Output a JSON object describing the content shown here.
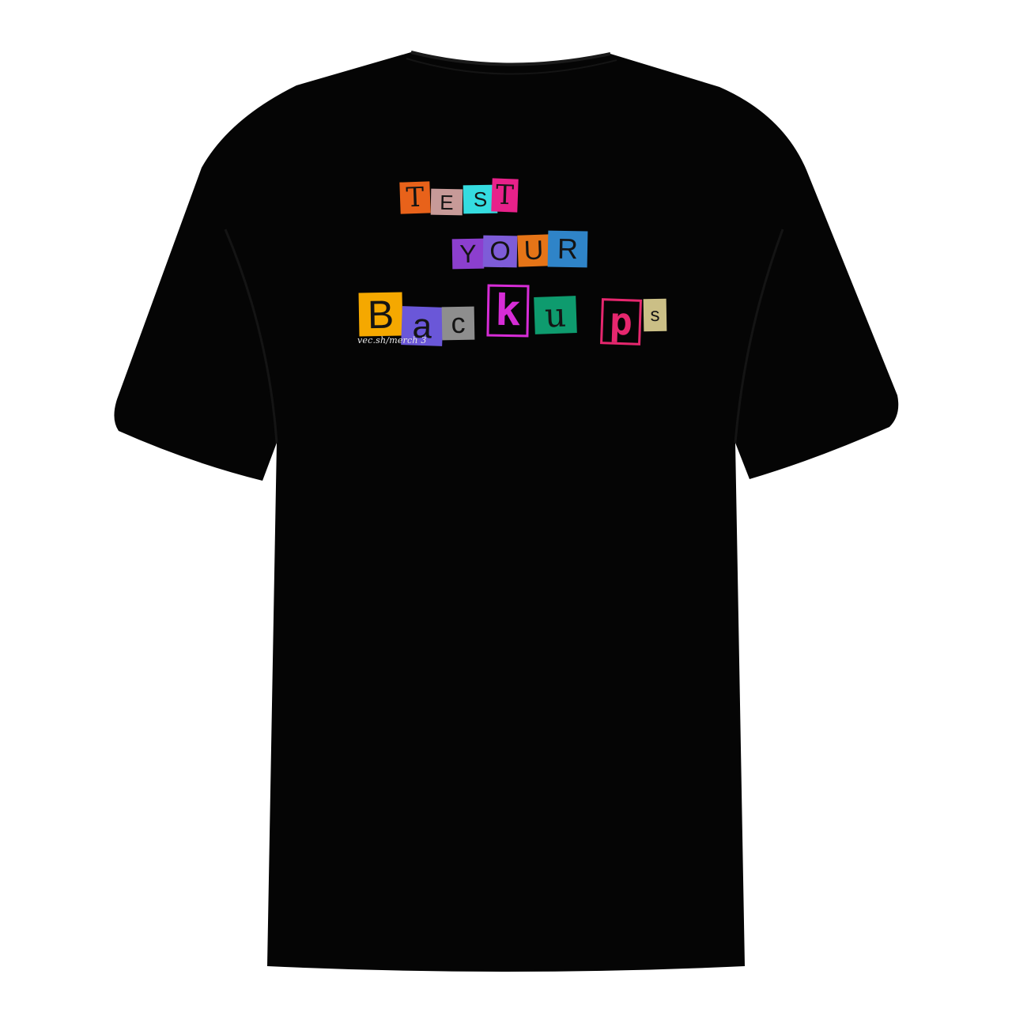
{
  "shirt": {
    "color": "#050505",
    "background": "#ffffff"
  },
  "print": {
    "lines": [
      [
        {
          "char": "T",
          "bg": "#e8621a",
          "fg": "#141414",
          "style": "serif"
        },
        {
          "char": "E",
          "bg": "#c79a98",
          "fg": "#141414",
          "style": "sans"
        },
        {
          "char": "S",
          "bg": "#35dce0",
          "fg": "#141414",
          "style": "sans"
        },
        {
          "char": "T",
          "bg": "#e8218a",
          "fg": "#141414",
          "style": "serif"
        }
      ],
      [
        {
          "char": "Y",
          "bg": "#8c3fce",
          "fg": "#141414",
          "style": "sans"
        },
        {
          "char": "O",
          "bg": "#7e5cd8",
          "fg": "#141414",
          "style": "sans"
        },
        {
          "char": "U",
          "bg": "#e57417",
          "fg": "#141414",
          "style": "sans"
        },
        {
          "char": "R",
          "bg": "#2f84c8",
          "fg": "#141414",
          "style": "sans"
        }
      ],
      [
        {
          "char": "B",
          "bg": "#f5a800",
          "fg": "#141414",
          "style": "sans"
        },
        {
          "char": "a",
          "bg": "#6a57d8",
          "fg": "#141414",
          "style": "sans"
        },
        {
          "char": "c",
          "bg": "#8e8e8e",
          "fg": "#141414",
          "style": "sans"
        },
        {
          "char": "k",
          "bg": "#d62cd6",
          "fg": "#d62cd6",
          "style": "outline"
        },
        {
          "char": "u",
          "bg": "#0e9b6e",
          "fg": "#141414",
          "style": "serif"
        },
        {
          "char": "p",
          "bg": "#e6276e",
          "fg": "#e6276e",
          "style": "outline"
        },
        {
          "char": "s",
          "bg": "#cbbf86",
          "fg": "#141414",
          "style": "sans"
        }
      ]
    ],
    "signature": "vec.sh/merch 3"
  }
}
